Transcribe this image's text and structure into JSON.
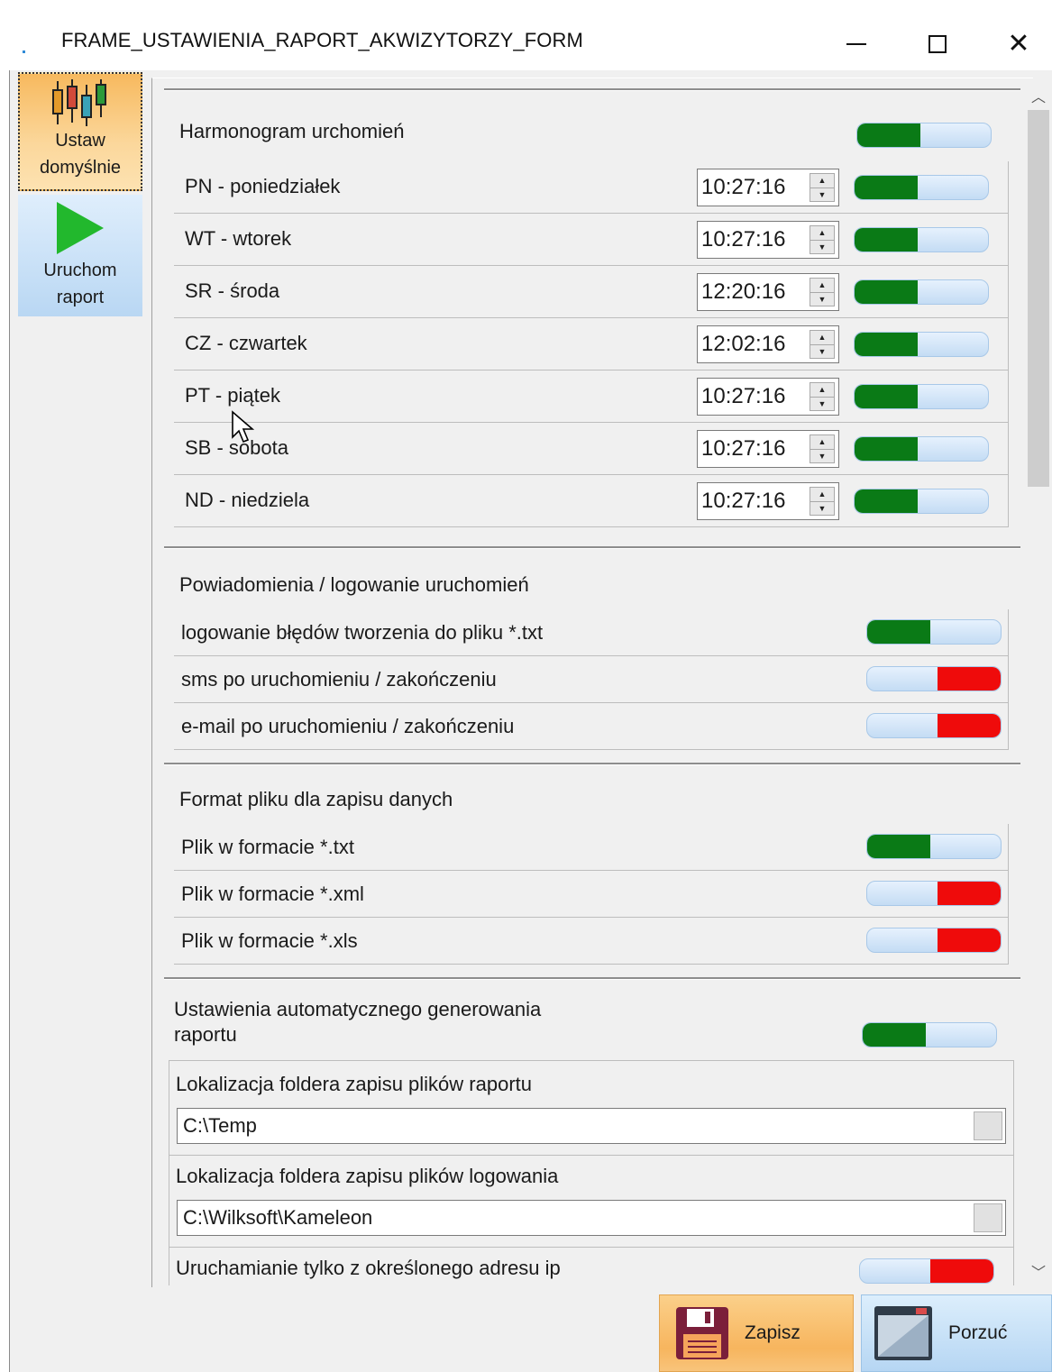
{
  "window": {
    "title": "FRAME_USTAWIENIA_RAPORT_AKWIZYTORZY_FORM"
  },
  "toolbar": {
    "set_default_line1": "Ustaw",
    "set_default_line2": "domyślnie",
    "run_report_line1": "Uruchom",
    "run_report_line2": "raport"
  },
  "schedule": {
    "title": "Harmonogram urchomień",
    "enabled": true,
    "days": [
      {
        "label": "PN - poniedziałek",
        "time": "10:27:16",
        "enabled": true
      },
      {
        "label": "WT - wtorek",
        "time": "10:27:16",
        "enabled": true
      },
      {
        "label": "SR - środa",
        "time": "12:20:16",
        "enabled": true
      },
      {
        "label": "CZ - czwartek",
        "time": "12:02:16",
        "enabled": true
      },
      {
        "label": "PT - piątek",
        "time": "10:27:16",
        "enabled": true
      },
      {
        "label": "SB - sobota",
        "time": "10:27:16",
        "enabled": true
      },
      {
        "label": "ND - niedziela",
        "time": "10:27:16",
        "enabled": true
      }
    ]
  },
  "notifications": {
    "title": "Powiadomienia / logowanie uruchomień",
    "items": [
      {
        "label": "logowanie błędów tworzenia do pliku  *.txt",
        "enabled": true
      },
      {
        "label": "sms po uruchomieniu / zakończeniu",
        "enabled": false
      },
      {
        "label": "e-mail po uruchomieniu / zakończeniu",
        "enabled": false
      }
    ]
  },
  "file_format": {
    "title": "Format pliku dla zapisu danych",
    "items": [
      {
        "label": "Plik w formacie *.txt",
        "enabled": true
      },
      {
        "label": "Plik w formacie *.xml",
        "enabled": false
      },
      {
        "label": "Plik w formacie *.xls",
        "enabled": false
      }
    ]
  },
  "auto_generation": {
    "title_line1": "Ustawienia automatycznego generowania",
    "title_line2": "raportu",
    "enabled": true,
    "report_folder_label": "Lokalizacja foldera zapisu plików raportu",
    "report_folder_value": "C:\\Temp",
    "log_folder_label": "Lokalizacja foldera zapisu plików logowania",
    "log_folder_value": "C:\\Wilksoft\\Kameleon",
    "ip_only_label": "Uruchamianie tylko z określonego adresu ip",
    "ip_only_enabled": false
  },
  "buttons": {
    "save": "Zapisz",
    "cancel": "Porzuć"
  },
  "colors": {
    "toggle_on": "#0a7a16",
    "toggle_off": "#ef0b0b",
    "toggle_track": "#c4dcf4",
    "orange_button": "#f7b55e",
    "blue_button": "#b6d6f3"
  }
}
